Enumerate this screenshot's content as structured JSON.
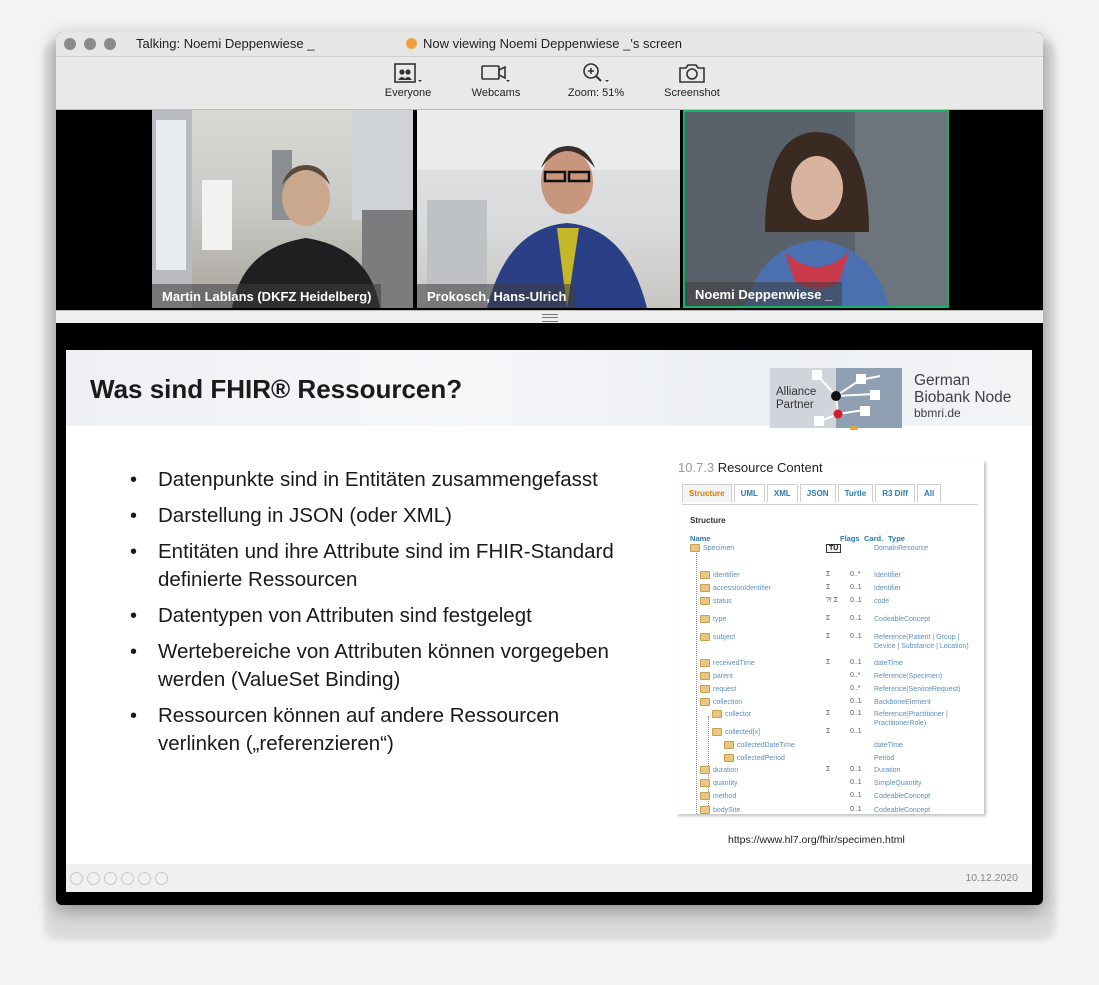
{
  "window": {
    "talking": "Talking: Noemi Deppenwiese _",
    "viewing": "Now viewing Noemi Deppenwiese _'s screen"
  },
  "toolbar": [
    {
      "label": "Everyone",
      "icon": "gallery-view-icon"
    },
    {
      "label": "Webcams",
      "icon": "webcam-icon"
    },
    {
      "label": "Zoom: 51%",
      "icon": "zoom-icon"
    },
    {
      "label": "Screenshot",
      "icon": "camera-icon"
    }
  ],
  "participants": [
    {
      "name": "Martin Lablans (DKFZ Heidelberg)"
    },
    {
      "name": "Prokosch, Hans-Ulrich"
    },
    {
      "name": "Noemi Deppenwiese _",
      "active": true
    }
  ],
  "slide": {
    "title": "Was sind FHIR® Ressourcen?",
    "logo": {
      "line1": "Alliance",
      "line2": "Partner",
      "org1": "German",
      "org2": "Biobank Node",
      "url": "bbmri.de"
    },
    "bullets": [
      "Datenpunkte sind in Entitäten zusammengefasst",
      "Darstellung in JSON (oder XML)",
      "Entitäten und ihre Attribute sind im FHIR-Standard definierte Ressourcen",
      "Datentypen von Attributen sind festgelegt",
      "Wertebereiche von Attributen können vorgegeben werden (ValueSet Binding)",
      "Ressourcen können auf andere Ressourcen verlinken („referenzieren“)"
    ],
    "fhir": {
      "section_num": "10.7.3",
      "section_title": "Resource Content",
      "tabs": [
        "Structure",
        "UML",
        "XML",
        "JSON",
        "Turtle",
        "R3 Diff",
        "All"
      ],
      "structure_label": "Structure",
      "columns": [
        "Name",
        "Flags",
        "Card.",
        "Type"
      ],
      "rows": [
        {
          "name": "Specimen",
          "flags": "TU",
          "card": "",
          "type": "DomainResource"
        },
        {
          "name": "identifier",
          "flags": "Σ",
          "card": "0..*",
          "type": "Identifier"
        },
        {
          "name": "accessionIdentifier",
          "flags": "Σ",
          "card": "0..1",
          "type": "Identifier"
        },
        {
          "name": "status",
          "flags": "?! Σ",
          "card": "0..1",
          "type": "code"
        },
        {
          "name": "type",
          "flags": "Σ",
          "card": "0..1",
          "type": "CodeableConcept"
        },
        {
          "name": "subject",
          "flags": "Σ",
          "card": "0..1",
          "type": "Reference(Patient | Group | Device | Substance | Location)"
        },
        {
          "name": "receivedTime",
          "flags": "Σ",
          "card": "0..1",
          "type": "dateTime"
        },
        {
          "name": "parent",
          "flags": "",
          "card": "0..*",
          "type": "Reference(Specimen)"
        },
        {
          "name": "request",
          "flags": "",
          "card": "0..*",
          "type": "Reference(ServiceRequest)"
        },
        {
          "name": "collection",
          "flags": "",
          "card": "0..1",
          "type": "BackboneElement"
        },
        {
          "name": "collector",
          "flags": "Σ",
          "card": "0..1",
          "type": "Reference(Practitioner | PractitionerRole)"
        },
        {
          "name": "collected[x]",
          "flags": "Σ",
          "card": "0..1",
          "type": ""
        },
        {
          "name": "collectedDateTime",
          "flags": "",
          "card": "",
          "type": "dateTime"
        },
        {
          "name": "collectedPeriod",
          "flags": "",
          "card": "",
          "type": "Period"
        },
        {
          "name": "duration",
          "flags": "Σ",
          "card": "0..1",
          "type": "Duration"
        },
        {
          "name": "quantity",
          "flags": "",
          "card": "0..1",
          "type": "SimpleQuantity"
        },
        {
          "name": "method",
          "flags": "",
          "card": "0..1",
          "type": "CodeableConcept"
        },
        {
          "name": "bodySite",
          "flags": "",
          "card": "0..1",
          "type": "CodeableConcept"
        }
      ]
    },
    "source_url": "https://www.hl7.org/fhir/specimen.html",
    "date": "10.12.2020"
  }
}
